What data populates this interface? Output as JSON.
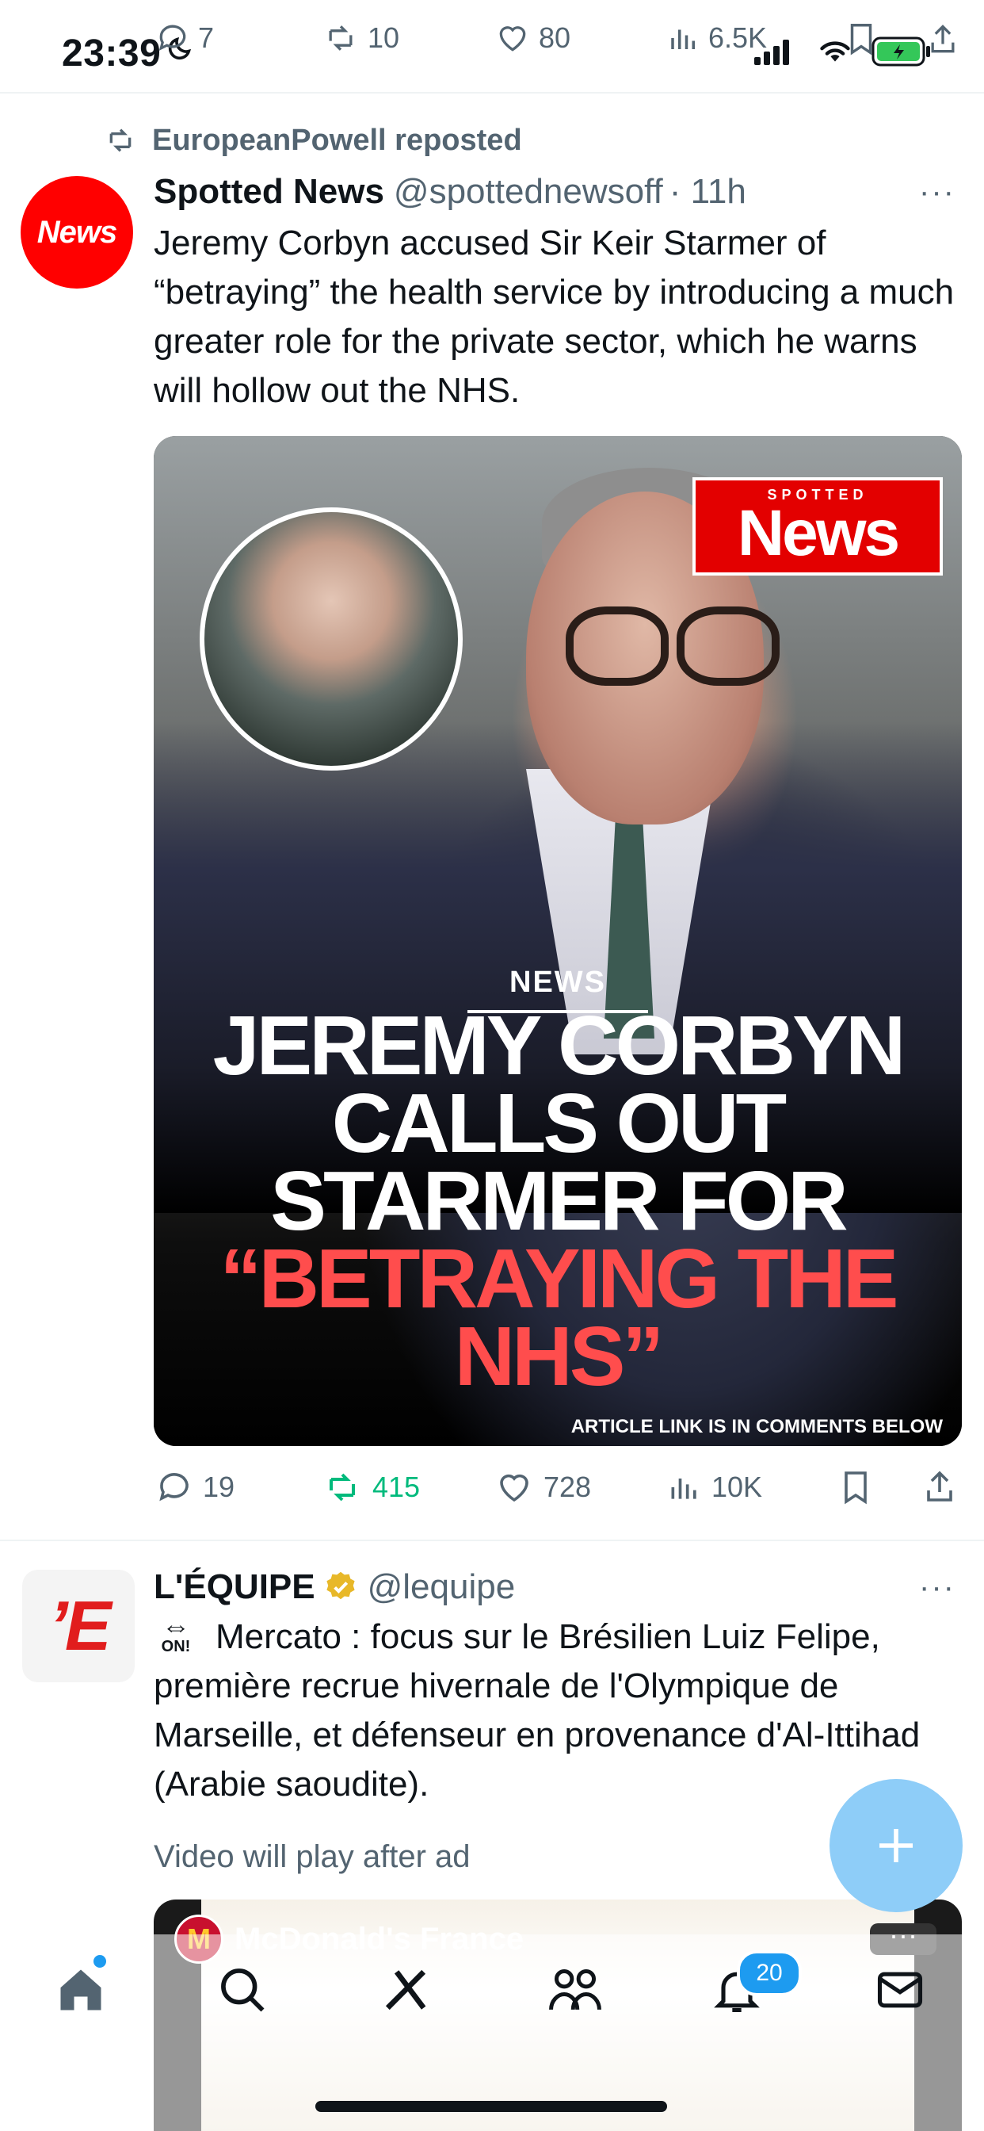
{
  "status_bar": {
    "time": "23:39",
    "battery_color": "#34c759"
  },
  "overlay_stats": {
    "replies": "7",
    "reposts": "10",
    "likes": "80",
    "views": "6.5K"
  },
  "post1": {
    "reposted_by": "EuropeanPowell reposted",
    "avatar_text": "News",
    "name": "Spotted News",
    "handle": "@spottednewsoff",
    "time": "· 11h",
    "more": "···",
    "text": "Jeremy Corbyn accused Sir Keir Starmer of “betraying” the health service by introducing a much greater role for the private sector, which he warns will hollow out the NHS.",
    "media": {
      "logo_small": "SPOTTED",
      "logo_big": "News",
      "kicker": "NEWS",
      "headline_white": "JEREMY CORBYN CALLS OUT STARMER FOR",
      "headline_red": "“BETRAYING THE NHS”",
      "footer": "ARTICLE LINK IS IN COMMENTS BELOW"
    },
    "actions": {
      "replies": "19",
      "reposts": "415",
      "likes": "728",
      "views": "10K"
    }
  },
  "post2": {
    "avatar_text": "’E",
    "name": "L'ÉQUIPE",
    "handle": "@lequipe",
    "more": "···",
    "badge_arrow": "⇔",
    "badge_label": "ON!",
    "text": "Mercato : focus sur le Brésilien Luiz Felipe, première recrue hivernale de l'Olympique de Marseille, et défenseur en provenance d'Al-Ittihad (Arabie saoudite).",
    "ad_note": "Video will play after ad",
    "video": {
      "advertiser": "McDonald's France",
      "logo": "M",
      "more": "···"
    }
  },
  "bottom_nav": {
    "notifications_count": "20",
    "accent_color": "#1d9bf0"
  }
}
